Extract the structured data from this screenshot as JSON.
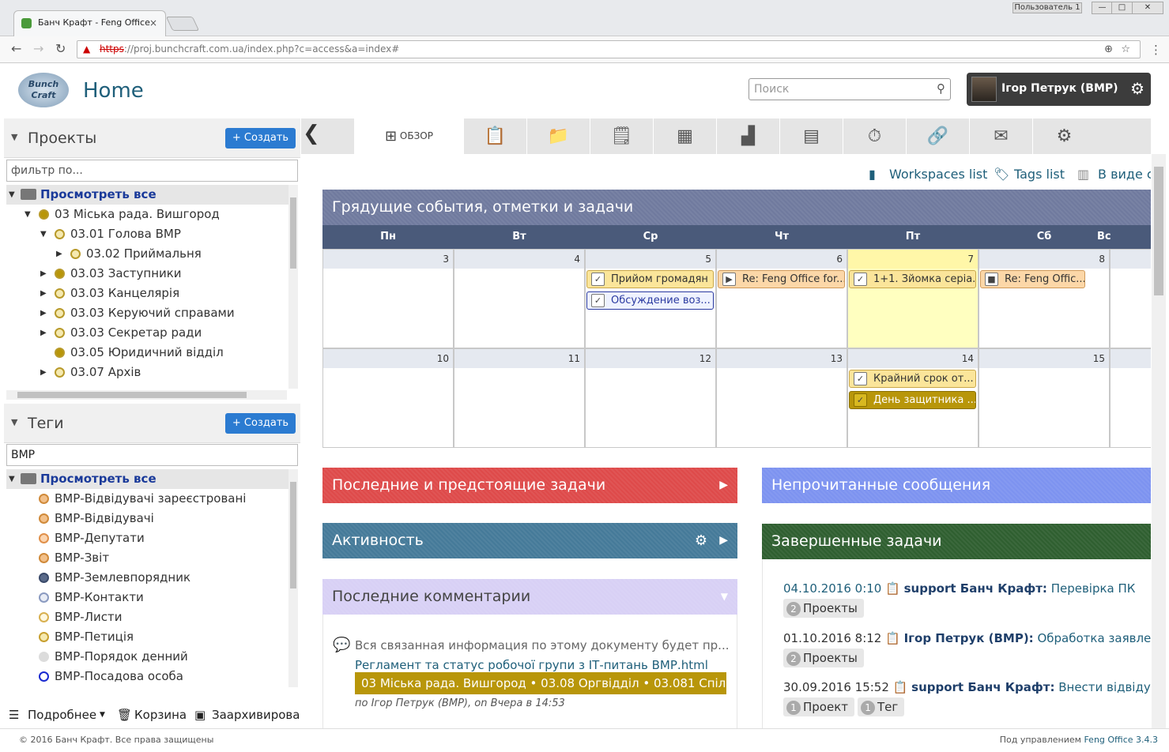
{
  "browser": {
    "tab_title": "Банч Крафт - Feng Office",
    "tab_close": "×",
    "user_chip": "Пользователь 1",
    "url_https": "https",
    "url_rest": "://proj.bunchcraft.com.ua/index.php?c=access&a=index#"
  },
  "header": {
    "logo_text": "Bunch Craft",
    "title": "Home",
    "search_placeholder": "Поиск",
    "user_name": "Ігор Петрук (BMP)"
  },
  "projects": {
    "title": "Проекты",
    "create_label": "+ Создать",
    "filter_placeholder": "фильтр по...",
    "view_all": "Просмотреть все",
    "items": [
      {
        "label": "03 Міська рада. Вишгород",
        "color": "#b8960a"
      },
      {
        "label": "03.01 Голова ВМР",
        "color": "#f5e9b0"
      },
      {
        "label": "03.02 Приймальня",
        "color": "#f5e9b0"
      },
      {
        "label": "03.03 Заступники",
        "color": "#b8960a"
      },
      {
        "label": "03.03 Канцелярія",
        "color": "#f5e9b0"
      },
      {
        "label": "03.03 Керуючий справами",
        "color": "#f5e9b0"
      },
      {
        "label": "03.03 Секретар ради",
        "color": "#f5e9b0"
      },
      {
        "label": "03.05 Юридичний відділ",
        "color": "#b8960a"
      },
      {
        "label": "03.07 Архів",
        "color": "#f5e9b0"
      }
    ]
  },
  "tags": {
    "title": "Теги",
    "create_label": "+ Создать",
    "filter_value": "ВМР",
    "view_all": "Просмотреть все",
    "items": [
      {
        "label": "ВМР-Відвідувачі зареєстровані",
        "color": "#f2c08a"
      },
      {
        "label": "ВМР-Відвідувачі",
        "color": "#f2c08a"
      },
      {
        "label": "ВМР-Депутати",
        "color": "#fbd5b0"
      },
      {
        "label": "ВМР-Звіт",
        "color": "#f2c08a"
      },
      {
        "label": "ВМР-Землевпорядник",
        "color": "#5a6a8a"
      },
      {
        "label": "ВМР-Контакти",
        "color": "#e8ecf5"
      },
      {
        "label": "ВМР-Листи",
        "color": "#fff8e0"
      },
      {
        "label": "ВМР-Петиція",
        "color": "#f5e9b0"
      },
      {
        "label": "ВМР-Порядок денний",
        "color": "#dcdcdc"
      },
      {
        "label": "ВМР-Посадова особа",
        "color": "#ffffff"
      }
    ]
  },
  "left_footer": {
    "details": "Подробнее",
    "trash": "Корзина",
    "archived": "Заархивированные"
  },
  "tabs": {
    "overview": "ОБЗОР"
  },
  "content_links": {
    "workspaces": "Workspaces list",
    "tags": "Tags list",
    "view": "В виде списка"
  },
  "calendar": {
    "title": "Грядущие события, отметки и задачи",
    "days": [
      "Пн",
      "Вт",
      "Ср",
      "Чт",
      "Пт",
      "Сб",
      "Вс"
    ],
    "week1": [
      "3",
      "4",
      "5",
      "6",
      "7",
      "8",
      ""
    ],
    "week2": [
      "10",
      "11",
      "12",
      "13",
      "14",
      "15",
      ""
    ],
    "events": {
      "e1": "Прийом громадян",
      "e2": "Обсуждение воз...",
      "e3": "Re: Feng Office for...",
      "e4": "1+1. Зйомка серіа...",
      "e5": "Re: Feng Offic...",
      "e6": "Крайний срок от...",
      "e7": "День защитника ..."
    }
  },
  "widgets": {
    "tasks": "Последние и предстоящие задачи",
    "activity": "Активность",
    "comments": "Последние комментарии",
    "unread": "Непрочитанные сообщения",
    "completed": "Завершенные задачи"
  },
  "comments": {
    "text": "Вся связанная информация по этому документу будет пр...",
    "doc": "Регламент та статус робочої групи з ІТ-питань ВМР.html",
    "path": "03 Міська рада. Вишгород • 03.08 Оргвідділ • 03.081 Спіл...",
    "by": "по Ігор Петрук (BMP), on Вчера в 14:53"
  },
  "completed_tasks": [
    {
      "date": "04.10.2016 0:10",
      "user": "support Банч Крафт:",
      "task": "Перевірка ПК",
      "tags": [
        {
          "n": "2",
          "label": "Проекты"
        }
      ]
    },
    {
      "date": "01.10.2016 8:12",
      "user": "Ігор Петрук (BMP):",
      "task": "Обработка заявления",
      "tags": [
        {
          "n": "2",
          "label": "Проекты"
        }
      ]
    },
    {
      "date": "30.09.2016 15:52",
      "user": "support Банч Крафт:",
      "task": "Внести відвідувача",
      "tags": [
        {
          "n": "1",
          "label": "Проект"
        },
        {
          "n": "1",
          "label": "Тег"
        }
      ]
    }
  ],
  "footer": {
    "copyright": "© 2016 Банч Крафт. Все права защищены",
    "powered": "Под управлением",
    "brand": "Feng Office 3.4.3"
  }
}
